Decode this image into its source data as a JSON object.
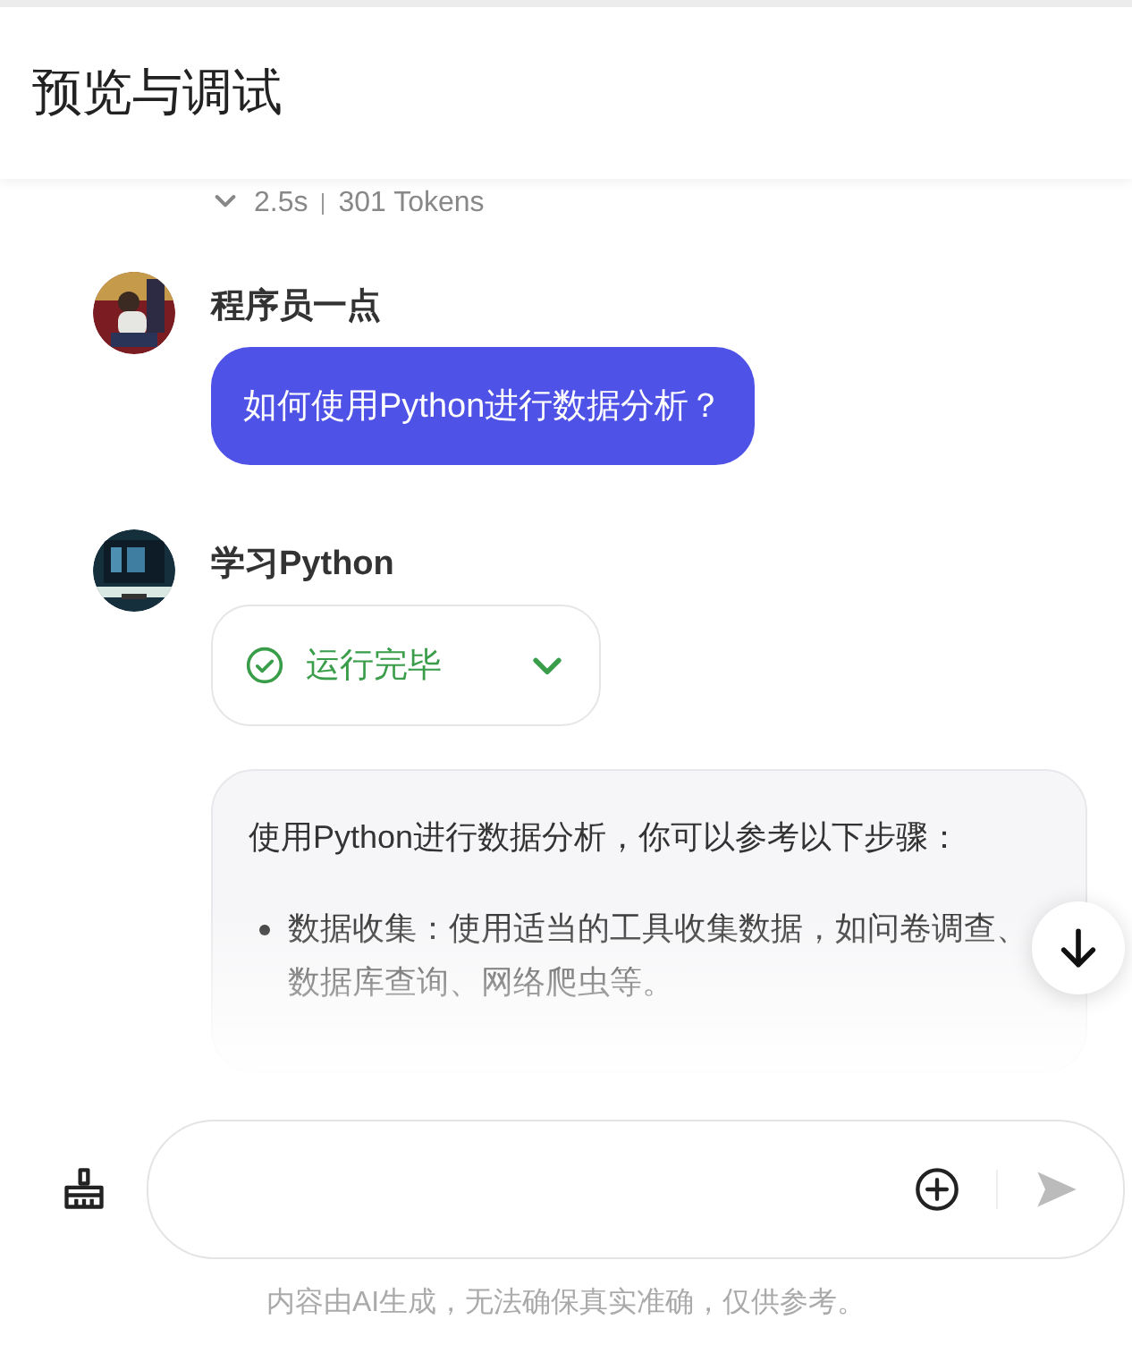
{
  "header": {
    "title": "预览与调试"
  },
  "meta": {
    "expanded": false,
    "duration": "2.5s",
    "tokens": "301 Tokens"
  },
  "messages": [
    {
      "kind": "user",
      "author": "程序员一点",
      "text": "如何使用Python进行数据分析？"
    },
    {
      "kind": "assistant",
      "author": "学习Python",
      "status": {
        "label": "运行完毕",
        "expanded": false
      },
      "answer": {
        "intro": "使用Python进行数据分析，你可以参考以下步骤：",
        "items": [
          {
            "text": "数据收集：使用适当的工具收集数据，如问卷调查、数据库查询、网络爬虫等。"
          }
        ]
      }
    }
  ],
  "footer": {
    "disclaimer": "内容由AI生成，无法确保真实准确，仅供参考。"
  }
}
